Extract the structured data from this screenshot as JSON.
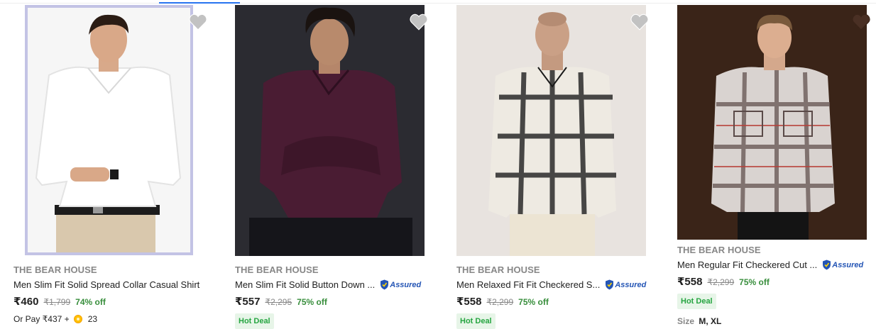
{
  "accent_colors": {
    "discount": "#388e3c",
    "hot_deal_bg": "#e7f5e8",
    "hot_deal_text": "#26a541",
    "assured": "#2455b5",
    "selected_border": "#c3c3e5"
  },
  "products": [
    {
      "image_alt": "Man in white slim fit shirt",
      "brand": "THE BEAR HOUSE",
      "title": "Men Slim Fit Solid Spread Collar Casual Shirt",
      "price": "₹460",
      "mrp": "₹1,799",
      "discount": "74% off",
      "pay_later": {
        "prefix": "Or Pay ₹437 +",
        "coins": "23"
      },
      "wishlist_icon": "heart-icon"
    },
    {
      "image_alt": "Man in maroon slim fit shirt",
      "brand": "THE BEAR HOUSE",
      "title": "Men Slim Fit Solid Button Down ...",
      "assured_label": "Assured",
      "price": "₹557",
      "mrp": "₹2,295",
      "discount": "75% off",
      "badge": "Hot Deal",
      "wishlist_icon": "heart-icon"
    },
    {
      "image_alt": "Man in black and white checkered shirt",
      "brand": "THE BEAR HOUSE",
      "title": "Men Relaxed Fit Fit Checkered S...",
      "assured_label": "Assured",
      "price": "₹558",
      "mrp": "₹2,299",
      "discount": "75% off",
      "badge": "Hot Deal",
      "wishlist_icon": "heart-icon"
    },
    {
      "image_alt": "Man in grey red checkered shirt",
      "brand": "THE BEAR HOUSE",
      "title": "Men Regular Fit Checkered Cut ...",
      "assured_label": "Assured",
      "price": "₹558",
      "mrp": "₹2,299",
      "discount": "75% off",
      "badge": "Hot Deal",
      "size_label": "Size",
      "sizes": "M, XL",
      "wishlist_icon": "heart-icon"
    }
  ]
}
